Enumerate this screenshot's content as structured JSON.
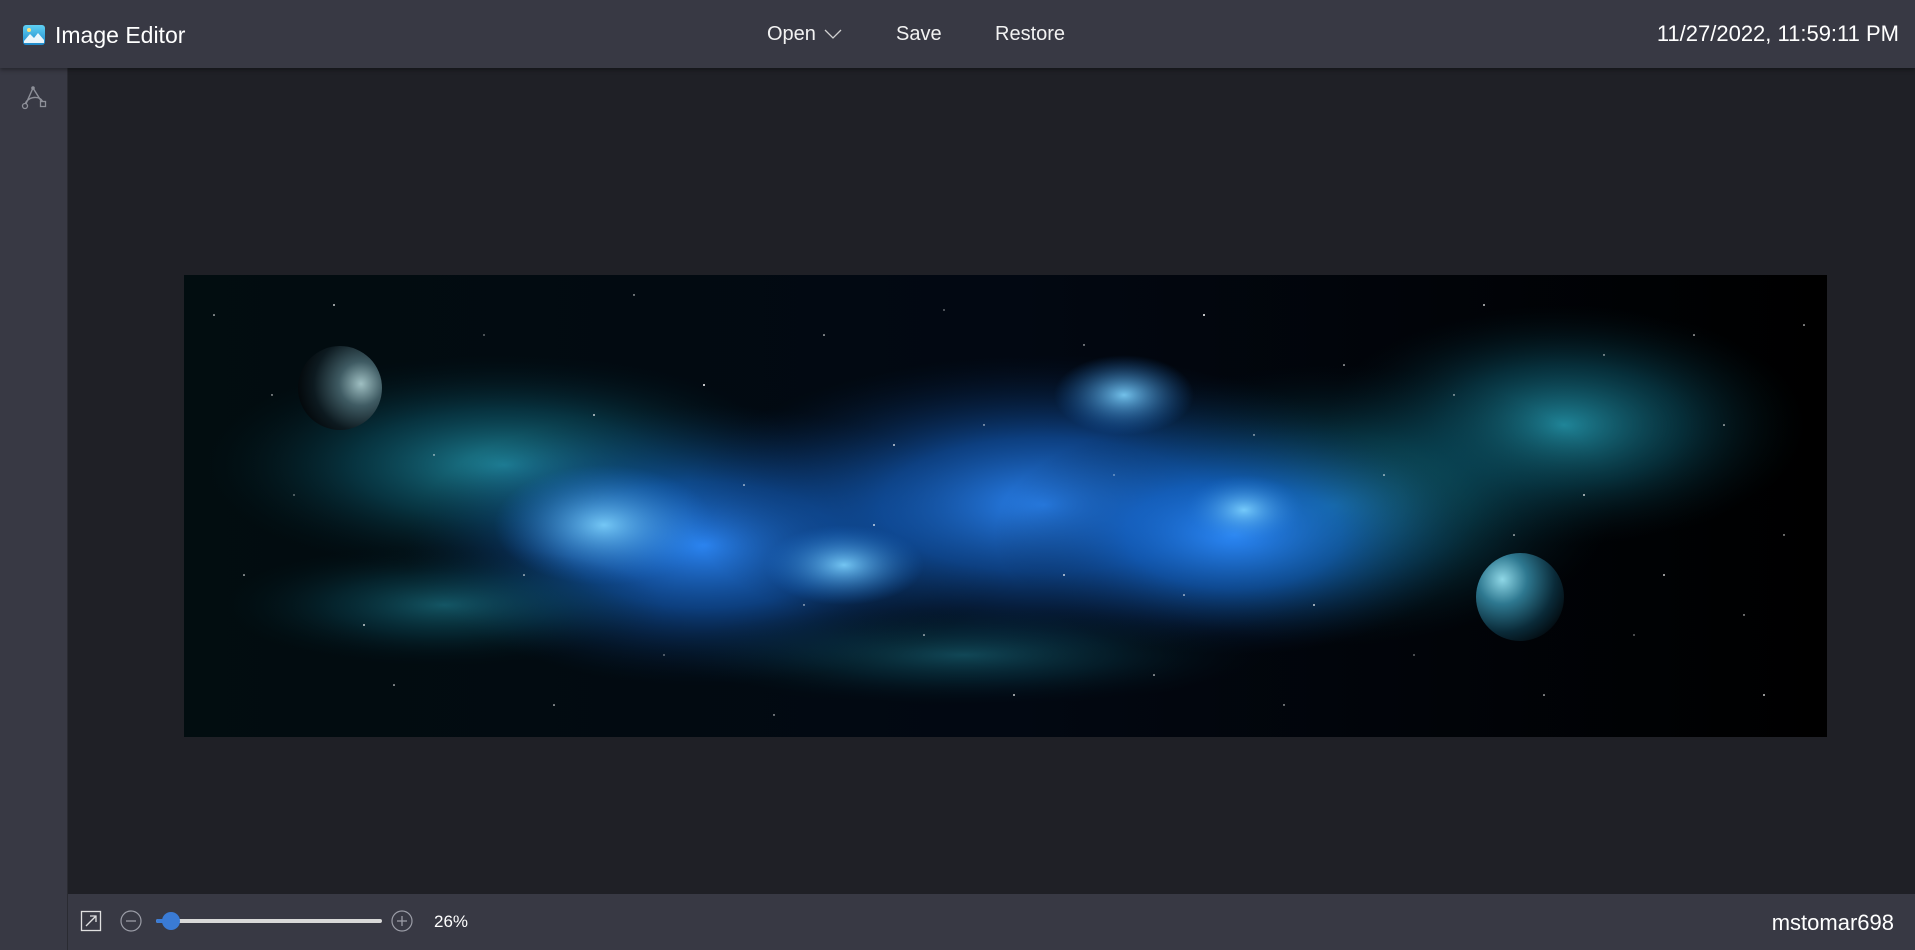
{
  "header": {
    "title": "Image Editor",
    "app_icon": "image-editor-icon",
    "menu": {
      "open_label": "Open",
      "save_label": "Save",
      "restore_label": "Restore"
    },
    "datetime": "11/27/2022, 11:59:11 PM"
  },
  "sidebar": {
    "tools": [
      {
        "icon": "shape-tool-icon"
      }
    ]
  },
  "canvas": {
    "image_description": "space-nebula-with-two-planets"
  },
  "footer": {
    "zoom_label": "26%",
    "zoom_fraction": 0.03,
    "username": "mstomar698",
    "icons": {
      "fit": "fit-to-screen-icon",
      "zoom_out": "zoom-out-icon",
      "zoom_in": "zoom-in-icon"
    }
  },
  "colors": {
    "header_bg": "#383944",
    "canvas_bg": "#1f2026",
    "accent": "#3a7bd5",
    "text": "#ffffff"
  }
}
